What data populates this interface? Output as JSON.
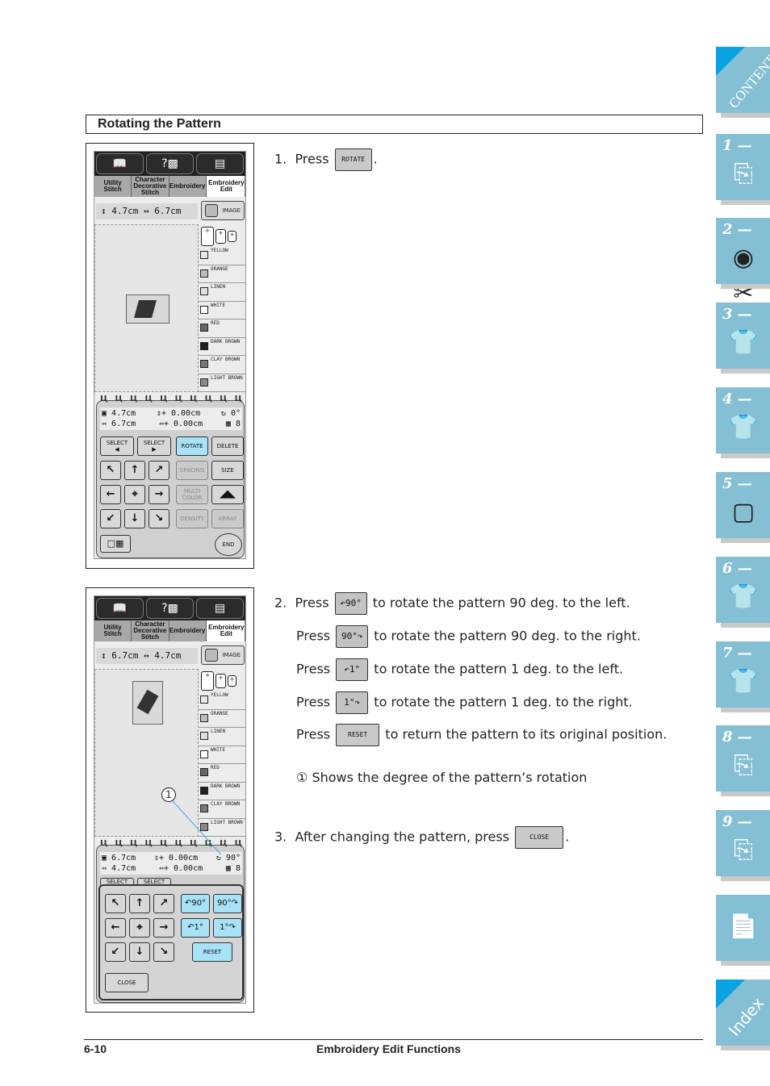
{
  "section": {
    "title": "Rotating the Pattern"
  },
  "screens": [
    {
      "tabs": [
        "Utility Stitch",
        "Character Decorative Stitch",
        "Embroidery",
        "Embroidery Edit"
      ],
      "size_readout": "4.7cm ↔ 6.7cm",
      "image_button": "IMAGE",
      "threads": [
        "YELLOW",
        "ORANGE",
        "LINEN",
        "WHITE",
        "RED",
        "DARK BROWN",
        "CLAY BROWN",
        "LIGHT BROWN"
      ],
      "readout": {
        "height": "4.7cm",
        "width": "6.7cm",
        "offset_v": "0.00cm",
        "offset_h": "0.00cm",
        "angle": "0°",
        "colors": "8"
      },
      "buttons": {
        "select_prev": "SELECT",
        "select_next": "SELECT",
        "rotate": "ROTATE",
        "delete": "DELETE",
        "spacing": "SPACING",
        "size": "SIZE",
        "multi_color": "MULTI COLOR",
        "density": "DENSITY",
        "array": "ARRAY",
        "end": "END"
      }
    },
    {
      "tabs": [
        "Utility Stitch",
        "Character Decorative Stitch",
        "Embroidery",
        "Embroidery Edit"
      ],
      "size_readout": "6.7cm ↔ 4.7cm",
      "image_button": "IMAGE",
      "threads": [
        "YELLOW",
        "ORANGE",
        "LINEN",
        "WHITE",
        "RED",
        "DARK BROWN",
        "CLAY BROWN",
        "LIGHT BROWN"
      ],
      "readout": {
        "height": "6.7cm",
        "width": "4.7cm",
        "offset_v": "0.00cm",
        "offset_h": "0.00cm",
        "angle": "90°",
        "colors": "8"
      },
      "buttons": {
        "select_prev": "SELECT",
        "select_next": "SELECT",
        "rotate_left_90": "90°",
        "rotate_right_90": "90°",
        "rotate_left_1": "1°",
        "rotate_right_1": "1°",
        "reset": "RESET",
        "close": "CLOSE"
      },
      "callout": "1"
    }
  ],
  "steps": {
    "step1": {
      "num": "1.",
      "press": "Press",
      "button": "ROTATE",
      "end": "."
    },
    "step2": {
      "num": "2.",
      "lines": [
        {
          "press": "Press",
          "button": "↶90°",
          "text": "to rotate the pattern 90 deg. to the left."
        },
        {
          "press": "Press",
          "button": "90°↷",
          "text": "to rotate the pattern 90 deg. to the right."
        },
        {
          "press": "Press",
          "button": "↶1°",
          "text": "to rotate the pattern 1 deg. to the left."
        },
        {
          "press": "Press",
          "button": "1°↷",
          "text": "to rotate the pattern 1 deg. to the right."
        },
        {
          "press": "Press",
          "button": "RESET",
          "text": "to return the pattern to its original position."
        }
      ],
      "note_num": "①",
      "note": "Shows the degree of the pattern’s rotation"
    },
    "step3": {
      "num": "3.",
      "text": "After changing the pattern, press",
      "button": "CLOSE",
      "end": "."
    }
  },
  "nav_tabs": [
    {
      "label": "CONTENTS",
      "icon": "contents"
    },
    {
      "label": "1 —",
      "icon": "sewing-machine-icon"
    },
    {
      "label": "2 —",
      "icon": "thread-spool-icon"
    },
    {
      "label": "3 —",
      "icon": "shirt-icon"
    },
    {
      "label": "4 —",
      "icon": "shirt-abc-icon"
    },
    {
      "label": "5 —",
      "icon": "embroidery-frame-icon"
    },
    {
      "label": "6 —",
      "icon": "shirt-design-icon"
    },
    {
      "label": "7 —",
      "icon": "shirt-cut-icon"
    },
    {
      "label": "8 —",
      "icon": "machine-care-icon"
    },
    {
      "label": "9 —",
      "icon": "troubleshoot-icon"
    },
    {
      "label": "",
      "icon": "documents-icon"
    },
    {
      "label": "Index",
      "icon": "index"
    }
  ],
  "footer": {
    "page": "6-10",
    "title": "Embroidery Edit Functions"
  },
  "colors": {
    "nav_tab": "#85bfd3",
    "nav_corner": "#0aa3e2",
    "active_button": "#a7e2f7"
  }
}
